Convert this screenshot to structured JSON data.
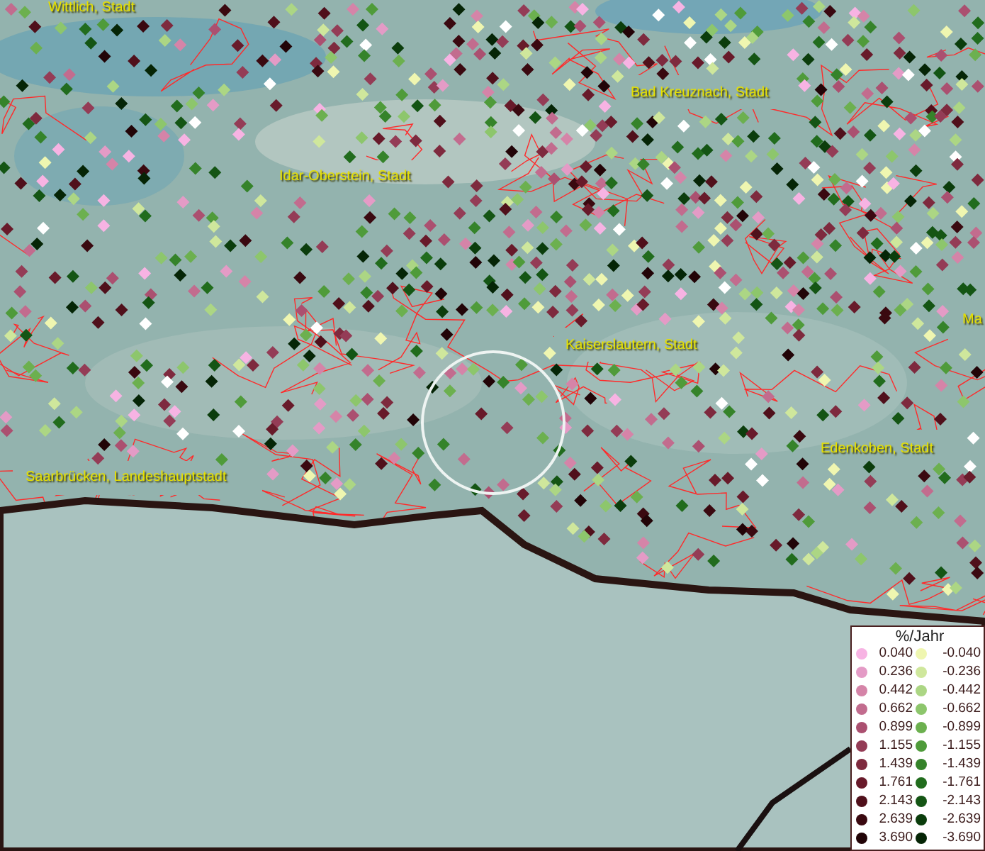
{
  "map": {
    "places": [
      {
        "name": "Wittlich, Stadt"
      },
      {
        "name": "Bad Kreuznach, Stadt"
      },
      {
        "name": "Idar-Oberstein, Stadt"
      },
      {
        "name": "Kaiserslautern, Stadt"
      },
      {
        "name": "Ma"
      },
      {
        "name": "Edenkoben, Stadt"
      },
      {
        "name": "Saarbrücken, Landeshauptstadt"
      }
    ]
  },
  "legend": {
    "title": "%/Jahr",
    "positive": [
      {
        "label": "0.040",
        "color": "#f7b3e3"
      },
      {
        "label": "0.236",
        "color": "#e49bc6"
      },
      {
        "label": "0.442",
        "color": "#d584a8"
      },
      {
        "label": "0.662",
        "color": "#c26c8e"
      },
      {
        "label": "0.899",
        "color": "#ab5070"
      },
      {
        "label": "1.155",
        "color": "#943c56"
      },
      {
        "label": "1.439",
        "color": "#7e2a3e"
      },
      {
        "label": "1.761",
        "color": "#681a2a"
      },
      {
        "label": "2.143",
        "color": "#50101b"
      },
      {
        "label": "2.639",
        "color": "#3a0910"
      },
      {
        "label": "3.690",
        "color": "#220407"
      }
    ],
    "negative": [
      {
        "label": "-0.040",
        "color": "#eff6b0"
      },
      {
        "label": "-0.236",
        "color": "#cfe79c"
      },
      {
        "label": "-0.442",
        "color": "#acd684"
      },
      {
        "label": "-0.662",
        "color": "#8dc66c"
      },
      {
        "label": "-0.899",
        "color": "#6cb04f"
      },
      {
        "label": "-1.155",
        "color": "#4f9b3a"
      },
      {
        "label": "-1.439",
        "color": "#35832a"
      },
      {
        "label": "-1.761",
        "color": "#216c1d"
      },
      {
        "label": "-2.143",
        "color": "#145514"
      },
      {
        "label": "-2.639",
        "color": "#0b3d0c"
      },
      {
        "label": "-3.690",
        "color": "#052506"
      }
    ]
  }
}
